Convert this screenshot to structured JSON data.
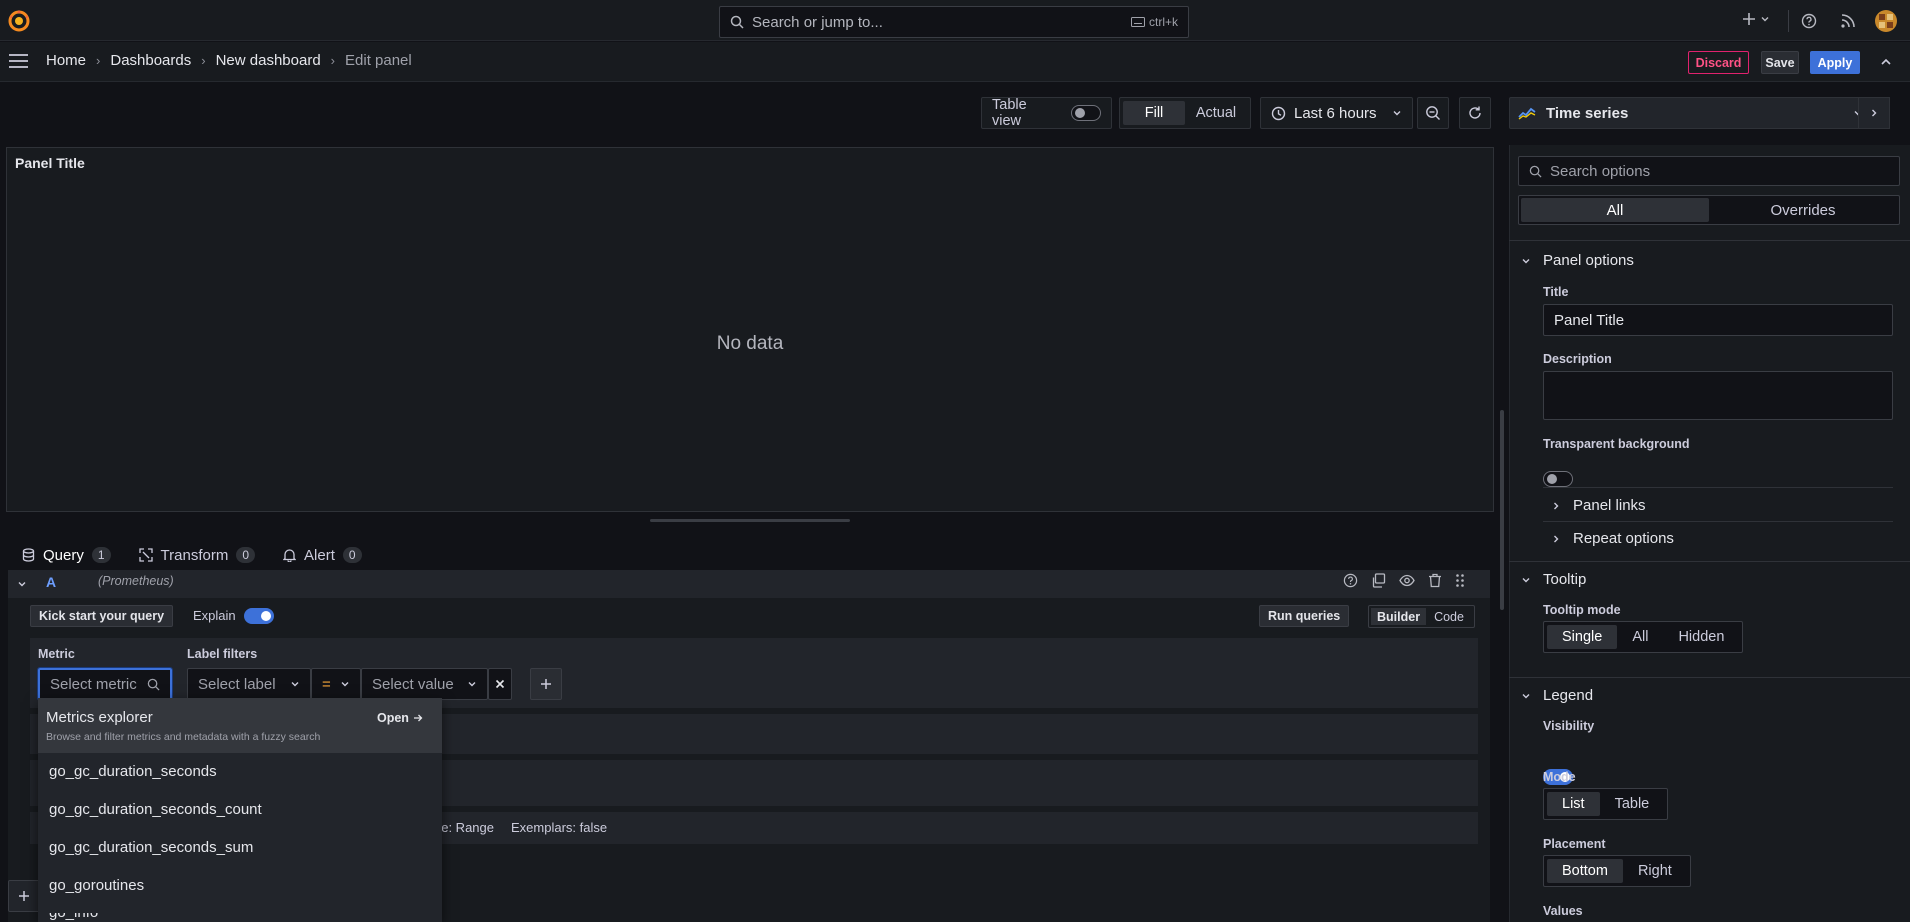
{
  "topbar": {
    "search_placeholder": "Search or jump to...",
    "search_shortcut": "ctrl+k"
  },
  "breadcrumb": {
    "items": [
      "Home",
      "Dashboards",
      "New dashboard",
      "Edit panel"
    ]
  },
  "actions": {
    "discard": "Discard",
    "save": "Save",
    "apply": "Apply"
  },
  "panel_toolbar": {
    "table_view": "Table view",
    "fill": "Fill",
    "actual": "Actual",
    "time_range": "Last 6 hours"
  },
  "panel": {
    "title": "Panel Title",
    "empty": "No data"
  },
  "tabs": [
    {
      "label": "Query",
      "count": "1"
    },
    {
      "label": "Transform",
      "count": "0"
    },
    {
      "label": "Alert",
      "count": "0"
    }
  ],
  "query": {
    "ref": "A",
    "datasource": "(Prometheus)",
    "kick_start": "Kick start your query",
    "explain": "Explain",
    "run_queries": "Run queries",
    "builder": "Builder",
    "code": "Code",
    "metric_label": "Metric",
    "metric_placeholder": "Select metric",
    "label_filters": "Label filters",
    "select_label": "Select label",
    "operator": "=",
    "select_value": "Select value",
    "options_partial": "pe: Range",
    "exemplars": "Exemplars: false"
  },
  "metric_dropdown": {
    "explorer_title": "Metrics explorer",
    "explorer_desc": "Browse and filter metrics and metadata with a fuzzy search",
    "open": "Open",
    "options": [
      "go_gc_duration_seconds",
      "go_gc_duration_seconds_count",
      "go_gc_duration_seconds_sum",
      "go_goroutines",
      "go_info"
    ]
  },
  "options_pane": {
    "visualization": "Time series",
    "search_placeholder": "Search options",
    "tab_all": "All",
    "tab_overrides": "Overrides",
    "panel_options": "Panel options",
    "title_label": "Title",
    "title_value": "Panel Title",
    "description_label": "Description",
    "transparent_label": "Transparent background",
    "panel_links": "Panel links",
    "repeat_options": "Repeat options",
    "tooltip": "Tooltip",
    "tooltip_mode_label": "Tooltip mode",
    "tooltip_modes": [
      "Single",
      "All",
      "Hidden"
    ],
    "legend": "Legend",
    "visibility_label": "Visibility",
    "mode_label": "Mode",
    "modes": [
      "List",
      "Table"
    ],
    "placement_label": "Placement",
    "placements": [
      "Bottom",
      "Right"
    ],
    "values_label": "Values"
  },
  "colors": {
    "accent": "#3d71d9",
    "discard": "#ff5286",
    "tab_underline": "#f55f3e"
  }
}
